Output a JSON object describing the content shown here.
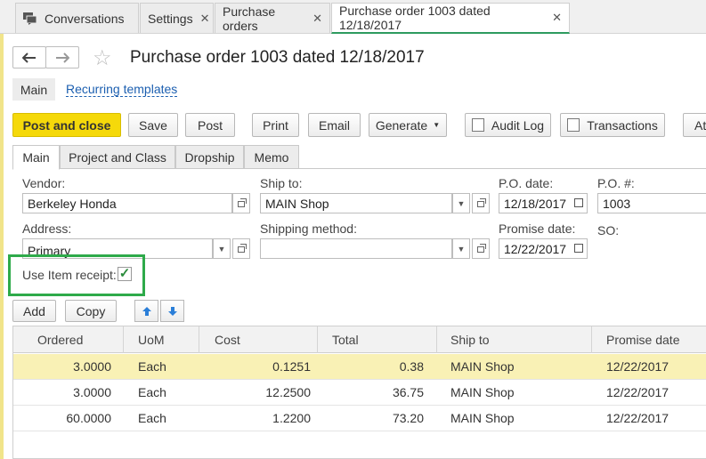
{
  "tabs": [
    {
      "label": "Conversations",
      "closable": false,
      "icon": "chat-icon"
    },
    {
      "label": "Settings",
      "closable": true
    },
    {
      "label": "Purchase orders",
      "closable": true
    },
    {
      "label": "Purchase order 1003 dated 12/18/2017",
      "closable": true,
      "active": true
    }
  ],
  "header": {
    "title": "Purchase order 1003 dated 12/18/2017",
    "back_icon": "arrow-left-icon",
    "forward_icon": "arrow-right-icon",
    "favorite_icon": "star-icon"
  },
  "subnav": {
    "main": "Main",
    "recurring": "Recurring templates"
  },
  "toolbar": {
    "post_close": "Post and close",
    "save": "Save",
    "post": "Post",
    "print": "Print",
    "email": "Email",
    "generate": "Generate",
    "audit_log": "Audit Log",
    "transactions": "Transactions",
    "overflow": "At"
  },
  "form_tabs": [
    "Main",
    "Project and Class",
    "Dropship",
    "Memo"
  ],
  "form": {
    "vendor_label": "Vendor:",
    "vendor": "Berkeley Honda",
    "ship_to_label": "Ship to:",
    "ship_to": "MAIN Shop",
    "po_date_label": "P.O. date:",
    "po_date": "12/18/2017",
    "po_num_label": "P.O. #:",
    "po_num": "1003",
    "address_label": "Address:",
    "address": "Primary",
    "shipping_label": "Shipping method:",
    "shipping": "",
    "promise_label": "Promise date:",
    "promise": "12/22/2017",
    "so_label": "SO:",
    "item_receipt_label": "Use Item receipt:",
    "item_receipt_checked": true
  },
  "grid_toolbar": {
    "add": "Add",
    "copy": "Copy",
    "up_icon": "arrow-up-icon",
    "down_icon": "arrow-down-icon"
  },
  "table": {
    "headers": [
      "Ordered",
      "UoM",
      "Cost",
      "Total",
      "Ship to",
      "Promise date"
    ],
    "rows": [
      {
        "ordered": "3.0000",
        "uom": "Each",
        "cost": "0.1251",
        "total": "0.38",
        "ship_to": "MAIN Shop",
        "promise": "12/22/2017"
      },
      {
        "ordered": "3.0000",
        "uom": "Each",
        "cost": "12.2500",
        "total": "36.75",
        "ship_to": "MAIN Shop",
        "promise": "12/22/2017"
      },
      {
        "ordered": "60.0000",
        "uom": "Each",
        "cost": "1.2200",
        "total": "73.20",
        "ship_to": "MAIN Shop",
        "promise": "12/22/2017"
      }
    ]
  },
  "colors": {
    "primary_button": "#f5d90a",
    "active_tab_underline": "#2e9b5f",
    "highlight": "#2eaa4a",
    "selected_row": "#f9f1b5",
    "link": "#1c5fb0"
  }
}
